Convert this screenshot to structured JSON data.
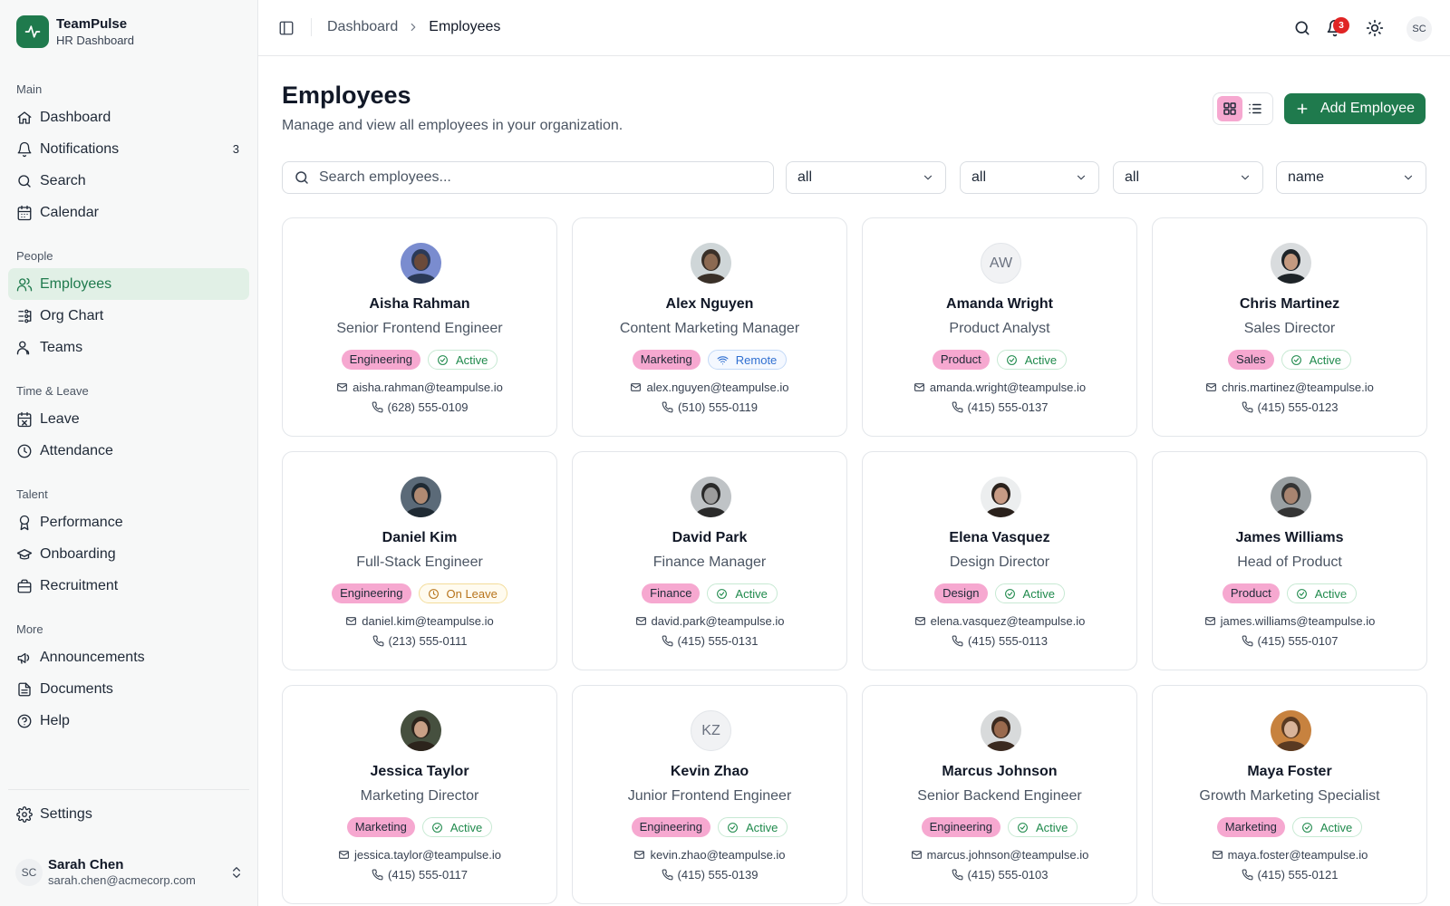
{
  "app": {
    "name": "TeamPulse",
    "subtitle": "HR Dashboard"
  },
  "sidebar": {
    "sections": [
      {
        "title": "Main",
        "items": [
          {
            "label": "Dashboard",
            "icon": "home-icon"
          },
          {
            "label": "Notifications",
            "icon": "bell-icon",
            "count": "3"
          },
          {
            "label": "Search",
            "icon": "search-icon"
          },
          {
            "label": "Calendar",
            "icon": "calendar-icon"
          }
        ]
      },
      {
        "title": "People",
        "items": [
          {
            "label": "Employees",
            "icon": "users-icon",
            "active": true
          },
          {
            "label": "Org Chart",
            "icon": "org-chart-icon"
          },
          {
            "label": "Teams",
            "icon": "team-icon"
          }
        ]
      },
      {
        "title": "Time & Leave",
        "items": [
          {
            "label": "Leave",
            "icon": "calendar-off-icon"
          },
          {
            "label": "Attendance",
            "icon": "clock-icon"
          }
        ]
      },
      {
        "title": "Talent",
        "items": [
          {
            "label": "Performance",
            "icon": "award-icon"
          },
          {
            "label": "Onboarding",
            "icon": "graduation-cap-icon"
          },
          {
            "label": "Recruitment",
            "icon": "briefcase-icon"
          }
        ]
      },
      {
        "title": "More",
        "items": [
          {
            "label": "Announcements",
            "icon": "megaphone-icon"
          },
          {
            "label": "Documents",
            "icon": "document-icon"
          },
          {
            "label": "Help",
            "icon": "help-circle-icon"
          }
        ]
      }
    ],
    "settings_label": "Settings",
    "user": {
      "initials": "SC",
      "name": "Sarah Chen",
      "email": "sarah.chen@acmecorp.com"
    }
  },
  "topbar": {
    "breadcrumb": [
      "Dashboard",
      "Employees"
    ],
    "notification_count": "3",
    "avatar_initials": "SC"
  },
  "page": {
    "title": "Employees",
    "subtitle": "Manage and view all employees in your organization.",
    "add_button": "Add Employee",
    "view_mode": "grid"
  },
  "filters": {
    "search_placeholder": "Search employees...",
    "department": "all",
    "status": "all",
    "location": "all",
    "sort": "name"
  },
  "colors": {
    "brand": "#1f7a4d",
    "department_badge": "#f6a8d0",
    "active": "#1f8a4c",
    "remote": "#2f6fd1",
    "on_leave": "#b7741b",
    "notification_badge": "#e02424"
  },
  "employees": [
    {
      "name": "Aisha Rahman",
      "role": "Senior Frontend Engineer",
      "department": "Engineering",
      "status": "Active",
      "email": "aisha.rahman@teampulse.io",
      "phone": "(628) 555-0109",
      "photo": true,
      "avatar_colors": [
        "#7a8ccf",
        "#2b3a57",
        "#6b4a3a"
      ]
    },
    {
      "name": "Alex Nguyen",
      "role": "Content Marketing Manager",
      "department": "Marketing",
      "status": "Remote",
      "email": "alex.nguyen@teampulse.io",
      "phone": "(510) 555-0119",
      "photo": true,
      "avatar_colors": [
        "#cfd6d8",
        "#3a3028",
        "#8c6a52"
      ]
    },
    {
      "name": "Amanda Wright",
      "role": "Product Analyst",
      "department": "Product",
      "status": "Active",
      "email": "amanda.wright@teampulse.io",
      "phone": "(415) 555-0137",
      "photo": false,
      "initials": "AW"
    },
    {
      "name": "Chris Martinez",
      "role": "Sales Director",
      "department": "Sales",
      "status": "Active",
      "email": "chris.martinez@teampulse.io",
      "phone": "(415) 555-0123",
      "photo": true,
      "avatar_colors": [
        "#d9dcde",
        "#1e2428",
        "#c49a80"
      ]
    },
    {
      "name": "Daniel Kim",
      "role": "Full-Stack Engineer",
      "department": "Engineering",
      "status": "On Leave",
      "email": "daniel.kim@teampulse.io",
      "phone": "(213) 555-0111",
      "photo": true,
      "avatar_colors": [
        "#5b6a78",
        "#1f2a33",
        "#b08a72"
      ]
    },
    {
      "name": "David Park",
      "role": "Finance Manager",
      "department": "Finance",
      "status": "Active",
      "email": "david.park@teampulse.io",
      "phone": "(415) 555-0131",
      "photo": true,
      "avatar_colors": [
        "#bfc3c6",
        "#2a2a2a",
        "#9c9c9c"
      ]
    },
    {
      "name": "Elena Vasquez",
      "role": "Design Director",
      "department": "Design",
      "status": "Active",
      "email": "elena.vasquez@teampulse.io",
      "phone": "(415) 555-0113",
      "photo": true,
      "avatar_colors": [
        "#eceeef",
        "#2a211c",
        "#c79b85"
      ]
    },
    {
      "name": "James Williams",
      "role": "Head of Product",
      "department": "Product",
      "status": "Active",
      "email": "james.williams@teampulse.io",
      "phone": "(415) 555-0107",
      "photo": true,
      "avatar_colors": [
        "#9aa0a3",
        "#343434",
        "#a88470"
      ]
    },
    {
      "name": "Jessica Taylor",
      "role": "Marketing Director",
      "department": "Marketing",
      "status": "Active",
      "email": "jessica.taylor@teampulse.io",
      "phone": "(415) 555-0117",
      "photo": true,
      "avatar_colors": [
        "#46503f",
        "#2c241c",
        "#c9a086"
      ]
    },
    {
      "name": "Kevin Zhao",
      "role": "Junior Frontend Engineer",
      "department": "Engineering",
      "status": "Active",
      "email": "kevin.zhao@teampulse.io",
      "phone": "(415) 555-0139",
      "photo": false,
      "initials": "KZ"
    },
    {
      "name": "Marcus Johnson",
      "role": "Senior Backend Engineer",
      "department": "Engineering",
      "status": "Active",
      "email": "marcus.johnson@teampulse.io",
      "phone": "(415) 555-0103",
      "photo": true,
      "avatar_colors": [
        "#d8dadb",
        "#3b2a20",
        "#9a6a4e"
      ]
    },
    {
      "name": "Maya Foster",
      "role": "Growth Marketing Specialist",
      "department": "Marketing",
      "status": "Active",
      "email": "maya.foster@teampulse.io",
      "phone": "(415) 555-0121",
      "photo": true,
      "avatar_colors": [
        "#c7823f",
        "#5a3a22",
        "#d9b49a"
      ]
    }
  ]
}
